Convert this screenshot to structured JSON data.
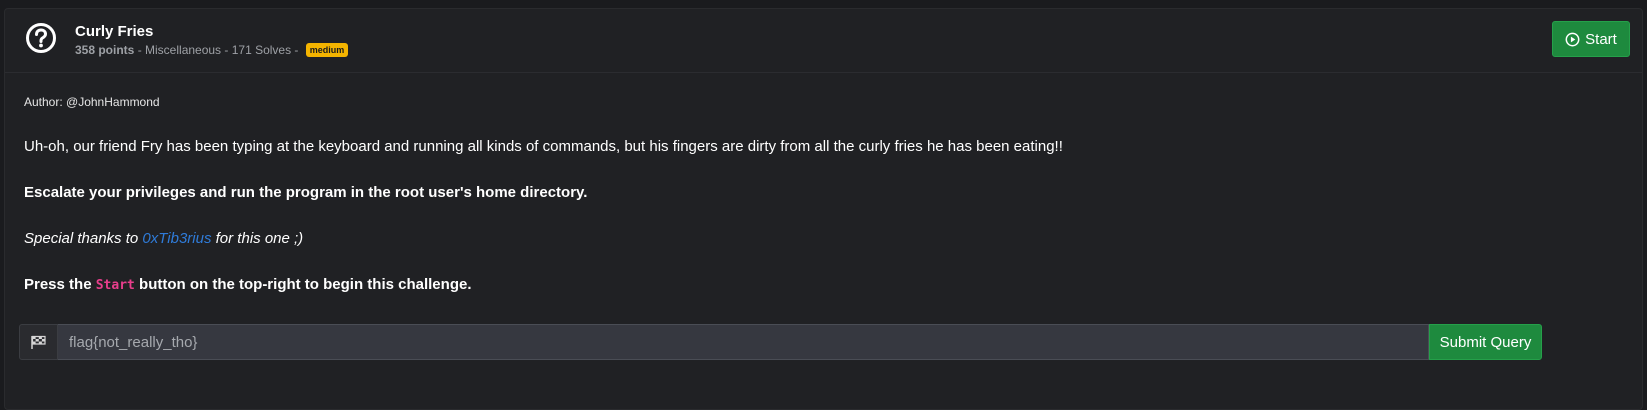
{
  "challenge": {
    "title": "Curly Fries",
    "points": "358 points",
    "meta_rest": " - Miscellaneous - 171 Solves - ",
    "difficulty": "medium",
    "start_label": "Start"
  },
  "description": {
    "author": "Author: @JohnHammond",
    "intro": "Uh-oh, our friend Fry has been typing at the keyboard and running all kinds of commands, but his fingers are dirty from all the curly fries he has been eating!!",
    "task": "Escalate your privileges and run the program in the root user's home directory.",
    "thanks_prefix": "Special thanks to ",
    "thanks_link": "0xTib3rius",
    "thanks_suffix": " for this one ;)",
    "press_prefix": "Press the ",
    "press_code": "Start",
    "press_suffix": " button on the top-right to begin this challenge."
  },
  "flag_form": {
    "placeholder": "flag{not_really_tho}",
    "value": "",
    "submit_label": "Submit Query"
  },
  "icons": {
    "challenge": "question-circle-icon",
    "start": "play-circle-icon",
    "flag": "checkered-flag-icon"
  },
  "colors": {
    "accent_green": "#1e8a3e",
    "badge_yellow": "#f4b400",
    "link_blue": "#2f7bd8",
    "code_pink": "#e83e8c"
  }
}
